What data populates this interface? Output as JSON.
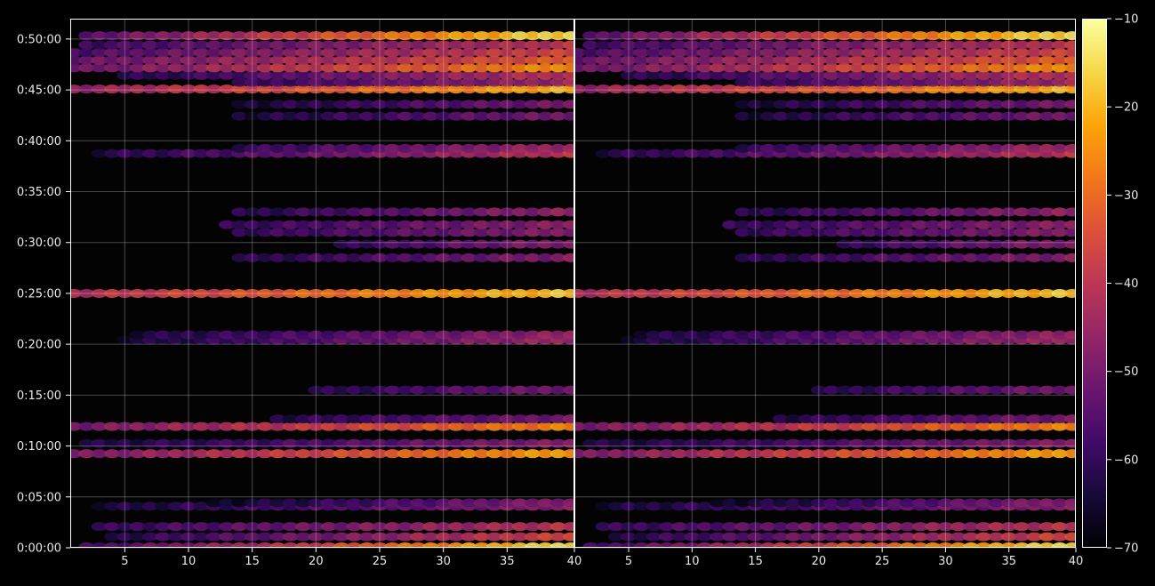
{
  "chart_data": {
    "type": "heatmap",
    "title": "",
    "xlabel": "",
    "ylabel": "",
    "panels": 2,
    "x_range": [
      1,
      40
    ],
    "x_ticks": [
      5,
      10,
      15,
      20,
      25,
      30,
      35,
      40
    ],
    "y_range_seconds": [
      0,
      3120
    ],
    "y_ticks": [
      {
        "label": "0:00:00",
        "seconds": 0
      },
      {
        "label": "0:05:00",
        "seconds": 300
      },
      {
        "label": "0:10:00",
        "seconds": 600
      },
      {
        "label": "0:15:00",
        "seconds": 900
      },
      {
        "label": "0:20:00",
        "seconds": 1200
      },
      {
        "label": "0:25:00",
        "seconds": 1500
      },
      {
        "label": "0:30:00",
        "seconds": 1800
      },
      {
        "label": "0:35:00",
        "seconds": 2100
      },
      {
        "label": "0:40:00",
        "seconds": 2400
      },
      {
        "label": "0:45:00",
        "seconds": 2700
      },
      {
        "label": "0:50:00",
        "seconds": 3000
      }
    ],
    "grid": true,
    "colormap": "inferno",
    "colorbar": {
      "range": [
        -70,
        -10
      ],
      "ticks": [
        -70,
        -60,
        -50,
        -40,
        -30,
        -20,
        -10
      ],
      "tick_labels": [
        "−70",
        "−60",
        "−50",
        "−40",
        "−30",
        "−20",
        "−10"
      ]
    },
    "bands": [
      {
        "t": 5,
        "x_start": 2,
        "v_start": -58,
        "v_end": -14
      },
      {
        "t": 65,
        "x_start": 4,
        "v_start": -62,
        "v_end": -36
      },
      {
        "t": 125,
        "x_start": 3,
        "v_start": -60,
        "v_end": -40
      },
      {
        "t": 245,
        "x_start": 3,
        "v_start": -64,
        "v_end": -47
      },
      {
        "t": 265,
        "x_start": 12,
        "v_start": -66,
        "v_end": -48
      },
      {
        "t": 555,
        "x_start": 1,
        "v_start": -50,
        "v_end": -22
      },
      {
        "t": 615,
        "x_start": 2,
        "v_start": -63,
        "v_end": -48
      },
      {
        "t": 715,
        "x_start": 1,
        "v_start": -50,
        "v_end": -26
      },
      {
        "t": 760,
        "x_start": 17,
        "v_start": -62,
        "v_end": -50
      },
      {
        "t": 930,
        "x_start": 20,
        "v_start": -62,
        "v_end": -50
      },
      {
        "t": 1225,
        "x_start": 5,
        "v_start": -64,
        "v_end": -44
      },
      {
        "t": 1255,
        "x_start": 6,
        "v_start": -63,
        "v_end": -46
      },
      {
        "t": 1500,
        "x_start": 1,
        "v_start": -42,
        "v_end": -18
      },
      {
        "t": 1710,
        "x_start": 14,
        "v_start": -62,
        "v_end": -48
      },
      {
        "t": 1790,
        "x_start": 22,
        "v_start": -60,
        "v_end": -48
      },
      {
        "t": 1860,
        "x_start": 14,
        "v_start": -60,
        "v_end": -48
      },
      {
        "t": 1905,
        "x_start": 13,
        "v_start": -60,
        "v_end": -47
      },
      {
        "t": 1980,
        "x_start": 14,
        "v_start": -62,
        "v_end": -46
      },
      {
        "t": 2325,
        "x_start": 3,
        "v_start": -62,
        "v_end": -40
      },
      {
        "t": 2355,
        "x_start": 14,
        "v_start": -60,
        "v_end": -44
      },
      {
        "t": 2545,
        "x_start": 14,
        "v_start": -64,
        "v_end": -50
      },
      {
        "t": 2615,
        "x_start": 14,
        "v_start": -64,
        "v_end": -50
      },
      {
        "t": 2705,
        "x_start": 1,
        "v_start": -46,
        "v_end": -20
      },
      {
        "t": 2745,
        "x_start": 14,
        "v_start": -60,
        "v_end": -44
      },
      {
        "t": 2785,
        "x_start": 5,
        "v_start": -62,
        "v_end": -40
      },
      {
        "t": 2830,
        "x_start": 1,
        "v_start": -52,
        "v_end": -24
      },
      {
        "t": 2875,
        "x_start": 1,
        "v_start": -52,
        "v_end": -32
      },
      {
        "t": 2920,
        "x_start": 1,
        "v_start": -56,
        "v_end": -36
      },
      {
        "t": 2965,
        "x_start": 2,
        "v_start": -58,
        "v_end": -40
      },
      {
        "t": 3020,
        "x_start": 2,
        "v_start": -54,
        "v_end": -14
      }
    ]
  }
}
